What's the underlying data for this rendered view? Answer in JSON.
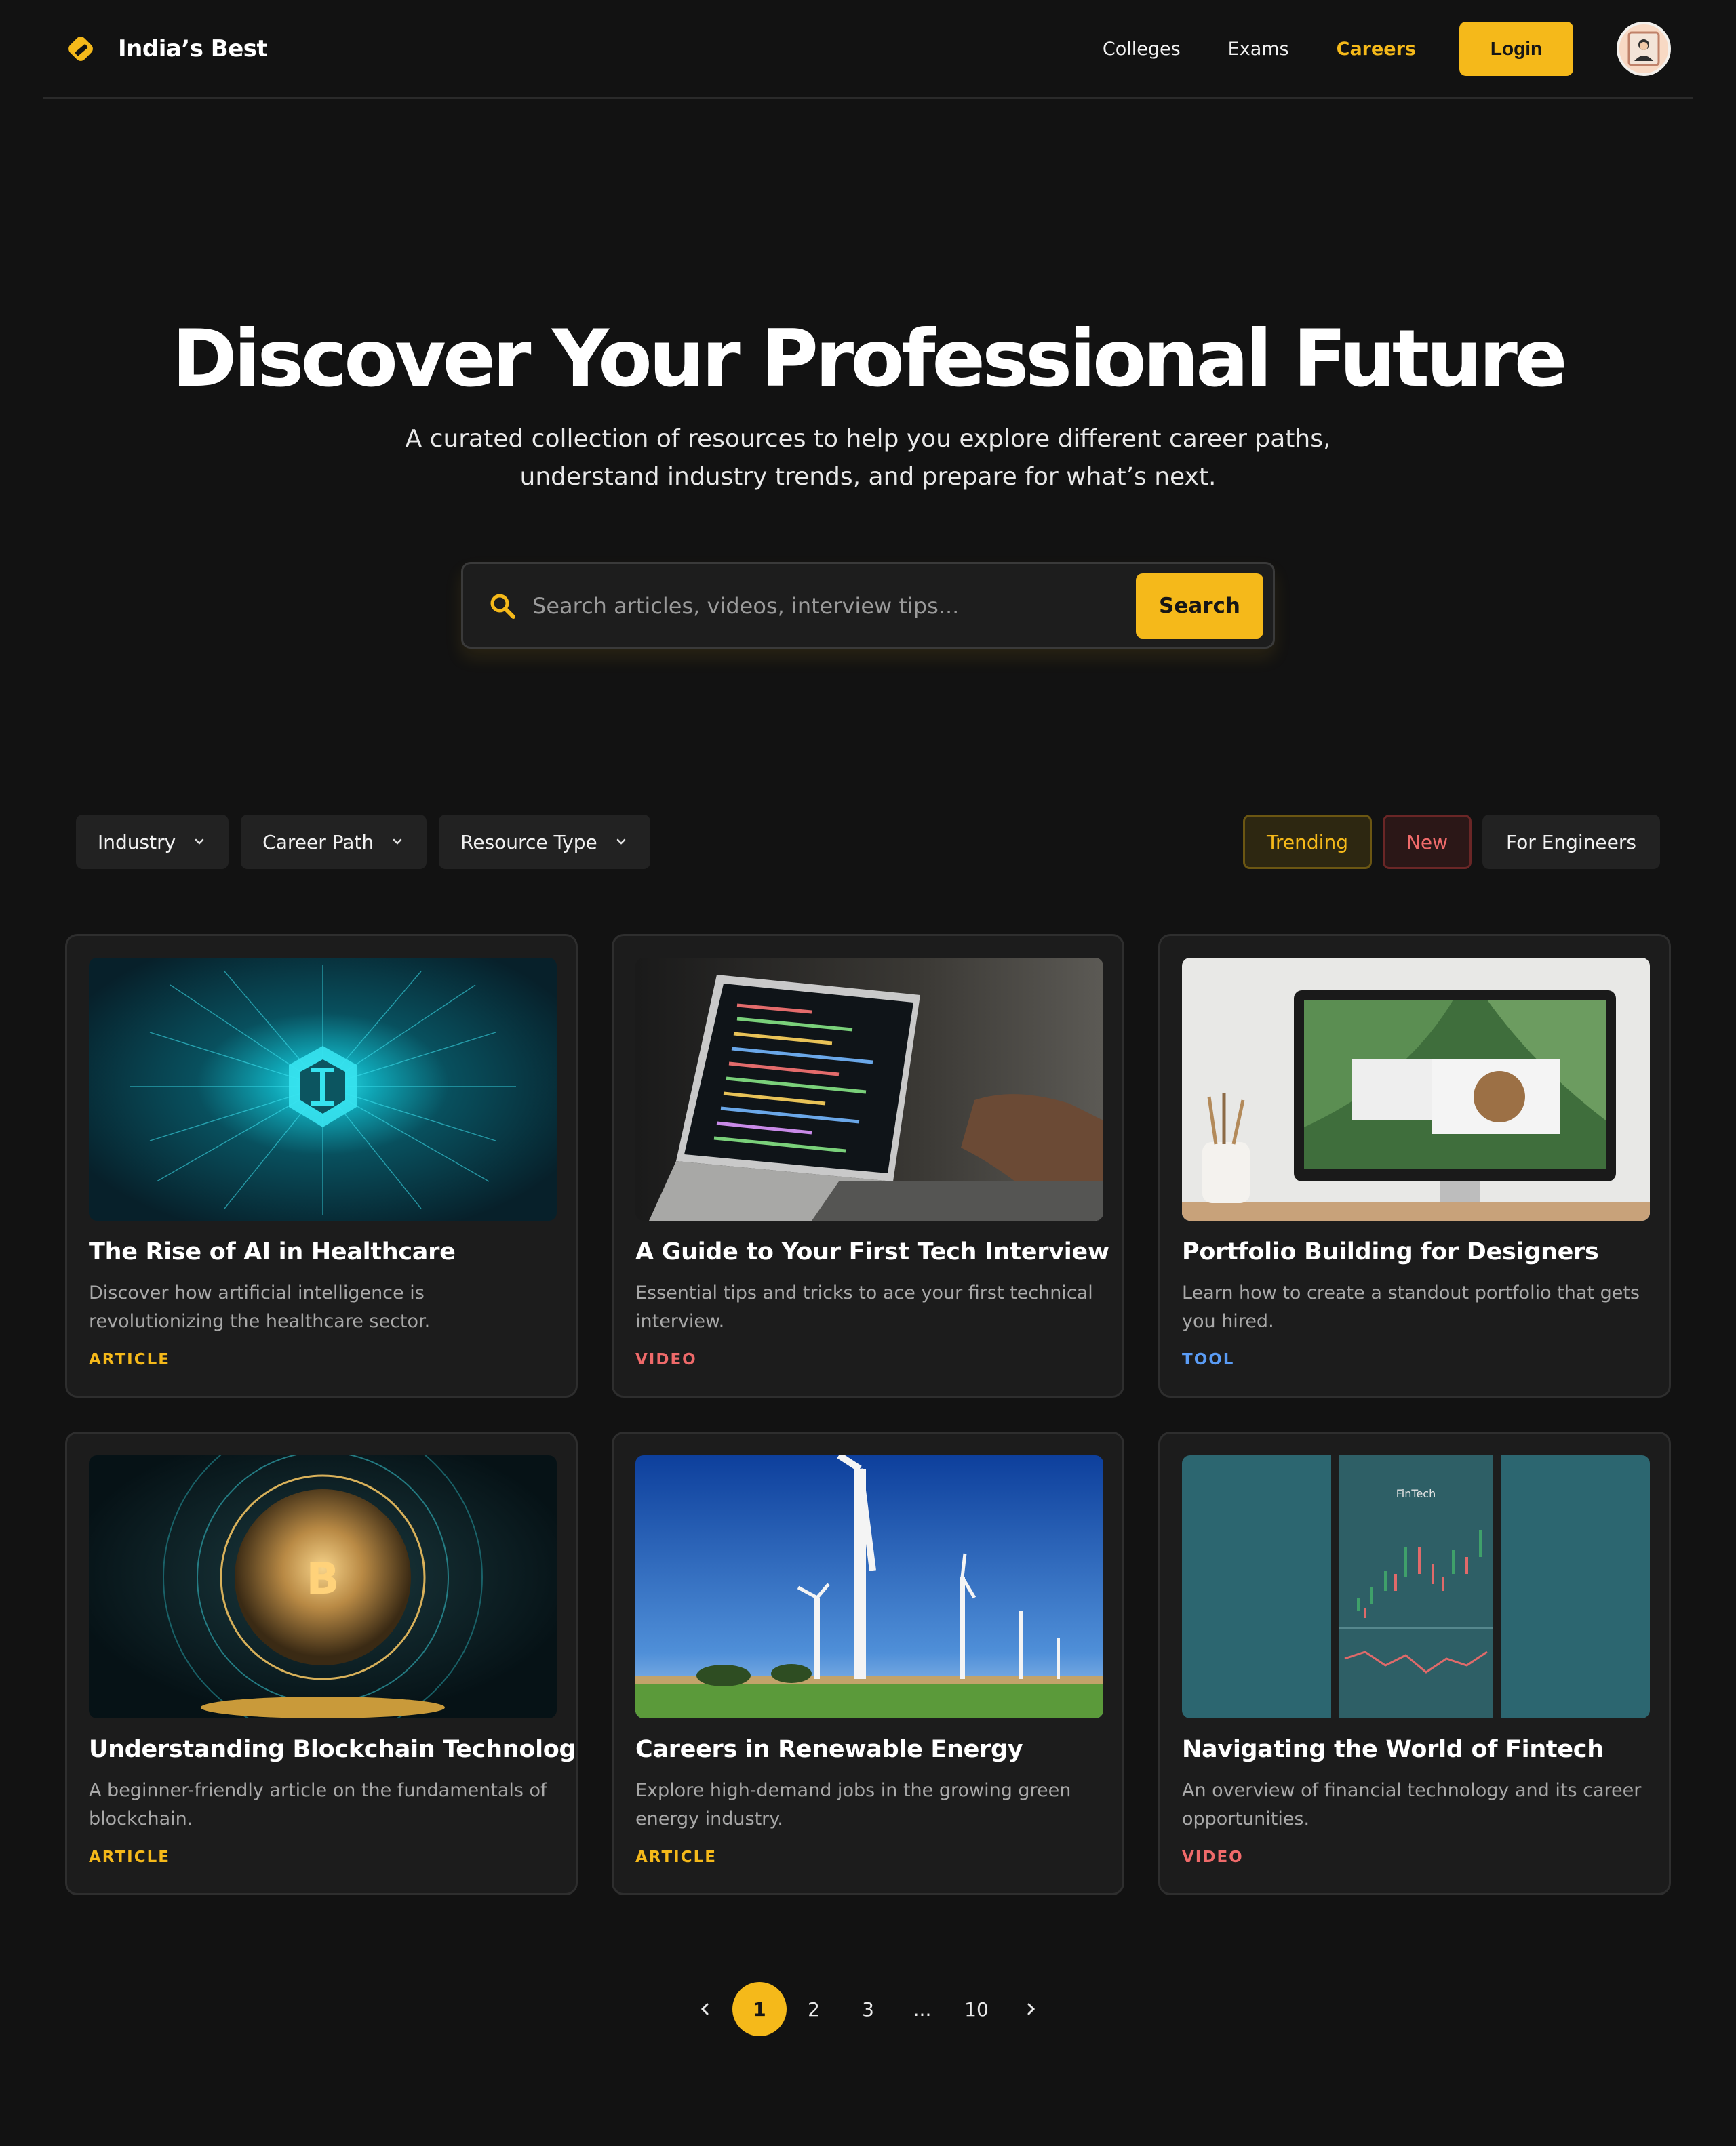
{
  "brand": {
    "name": "India’s Best",
    "logo_icon": "diamond-tag-icon",
    "accent": "#f5b91a"
  },
  "nav": {
    "links": [
      {
        "label": "Colleges",
        "active": false
      },
      {
        "label": "Exams",
        "active": false
      },
      {
        "label": "Careers",
        "active": true
      }
    ],
    "login_label": "Login",
    "avatar_icon": "user-avatar"
  },
  "hero": {
    "title": "Discover Your Professional Future",
    "subtitle": "A curated collection of resources to help you explore different career paths, understand industry trends, and prepare for what’s next."
  },
  "search": {
    "icon": "search-icon",
    "placeholder": "Search articles, videos, interview tips...",
    "value": "",
    "button_label": "Search"
  },
  "filters": {
    "dropdowns": [
      {
        "label": "Industry",
        "icon": "chevron-down-icon"
      },
      {
        "label": "Career Path",
        "icon": "chevron-down-icon"
      },
      {
        "label": "Resource Type",
        "icon": "chevron-down-icon"
      }
    ],
    "chips": [
      {
        "label": "Trending",
        "color": "#f5b91a"
      },
      {
        "label": "New",
        "color": "#ef6a6a"
      },
      {
        "label": "For Engineers",
        "color": "#f0f0f0"
      }
    ]
  },
  "cards": [
    {
      "title": "The Rise of AI in Healthcare",
      "description": "Discover how artificial intelligence is revolutionizing the healthcare sector.",
      "tag": "ARTICLE",
      "image": "ai-neural-glow-image"
    },
    {
      "title": "A Guide to Your First Tech Interview",
      "description": "Essential tips and tricks to ace your first technical interview.",
      "tag": "VIDEO",
      "image": "laptop-code-image"
    },
    {
      "title": "Portfolio Building for Designers",
      "description": "Learn how to create a standout portfolio that gets you hired.",
      "tag": "TOOL",
      "image": "desktop-monitor-image"
    },
    {
      "title": "Understanding Blockchain Technology",
      "description": "A beginner-friendly article on the fundamentals of blockchain.",
      "tag": "ARTICLE",
      "image": "blockchain-sphere-image"
    },
    {
      "title": "Careers in Renewable Energy",
      "description": "Explore high-demand jobs in the growing green energy industry.",
      "tag": "ARTICLE",
      "image": "wind-turbines-image"
    },
    {
      "title": "Navigating the World of Fintech",
      "description": "An overview of financial technology and its career opportunities.",
      "tag": "VIDEO",
      "image": "fintech-phone-chart-image",
      "image_caption": "FinTech"
    }
  ],
  "pagination": {
    "prev_icon": "chevron-left-icon",
    "next_icon": "chevron-right-icon",
    "pages": [
      "1",
      "2",
      "3",
      "...",
      "10"
    ],
    "current": "1"
  }
}
